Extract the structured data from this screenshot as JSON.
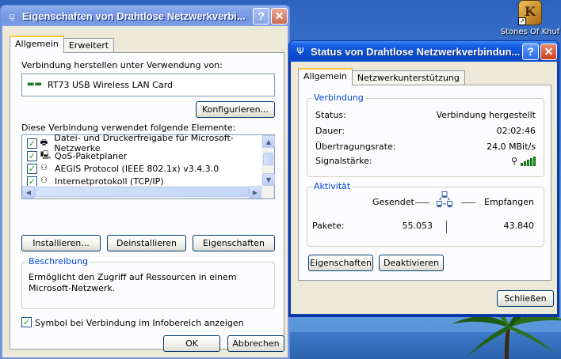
{
  "desktop": {
    "icon_label": "Stones Of Khuf",
    "icon_letter": "K"
  },
  "props_window": {
    "title": "Eigenschaften von Drahtlose Netzwerkverbi...",
    "help": "?",
    "close": "✕",
    "tabs": [
      "Allgemein",
      "Erweitert"
    ],
    "connect_using_label": "Verbindung herstellen unter Verwendung von:",
    "adapter_name": "RT73 USB Wireless LAN Card",
    "configure_button": "Konfigurieren...",
    "elements_label": "Diese Verbindung verwendet folgende Elemente:",
    "elements": [
      {
        "label": "Datei- und Druckerfreigabe für Microsoft-Netzwerke",
        "checked": true,
        "icon": "printer-share-icon"
      },
      {
        "label": "QoS-Paketplaner",
        "checked": true,
        "icon": "qos-icon"
      },
      {
        "label": "AEGIS Protocol (IEEE 802.1x) v3.4.3.0",
        "checked": true,
        "icon": "protocol-icon"
      },
      {
        "label": "Internetprotokoll (TCP/IP)",
        "checked": true,
        "icon": "protocol-icon"
      }
    ],
    "install_button": "Installieren...",
    "uninstall_button": "Deinstallieren",
    "properties_button": "Eigenschaften",
    "description_title": "Beschreibung",
    "description_text_1": "Ermöglicht den Zugriff auf Ressourcen in einem",
    "description_text_2": "Microsoft-Netzwerk.",
    "show_icon_label": "Symbol bei Verbindung im Infobereich anzeigen",
    "show_icon_checked": true,
    "ok_button": "OK",
    "cancel_button": "Abbrechen"
  },
  "status_window": {
    "title": "Status von Drahtlose Netzwerkverbindun...",
    "help": "?",
    "close": "✕",
    "tabs": [
      "Allgemein",
      "Netzwerkunterstützung"
    ],
    "connection_group": "Verbindung",
    "status_label": "Status:",
    "status_value": "Verbindung hergestellt",
    "duration_label": "Dauer:",
    "duration_value": "02:02:46",
    "speed_label": "Übertragungsrate:",
    "speed_value": "24,0 MBit/s",
    "signal_label": "Signalstärke:",
    "signal_bars": 5,
    "activity_group": "Aktivität",
    "sent_label": "Gesendet",
    "received_label": "Empfangen",
    "packets_label": "Pakete:",
    "packets_sent": "55.053",
    "packets_received": "43.840",
    "properties_button": "Eigenschaften",
    "disable_button": "Deaktivieren",
    "close_button": "Schließen"
  }
}
